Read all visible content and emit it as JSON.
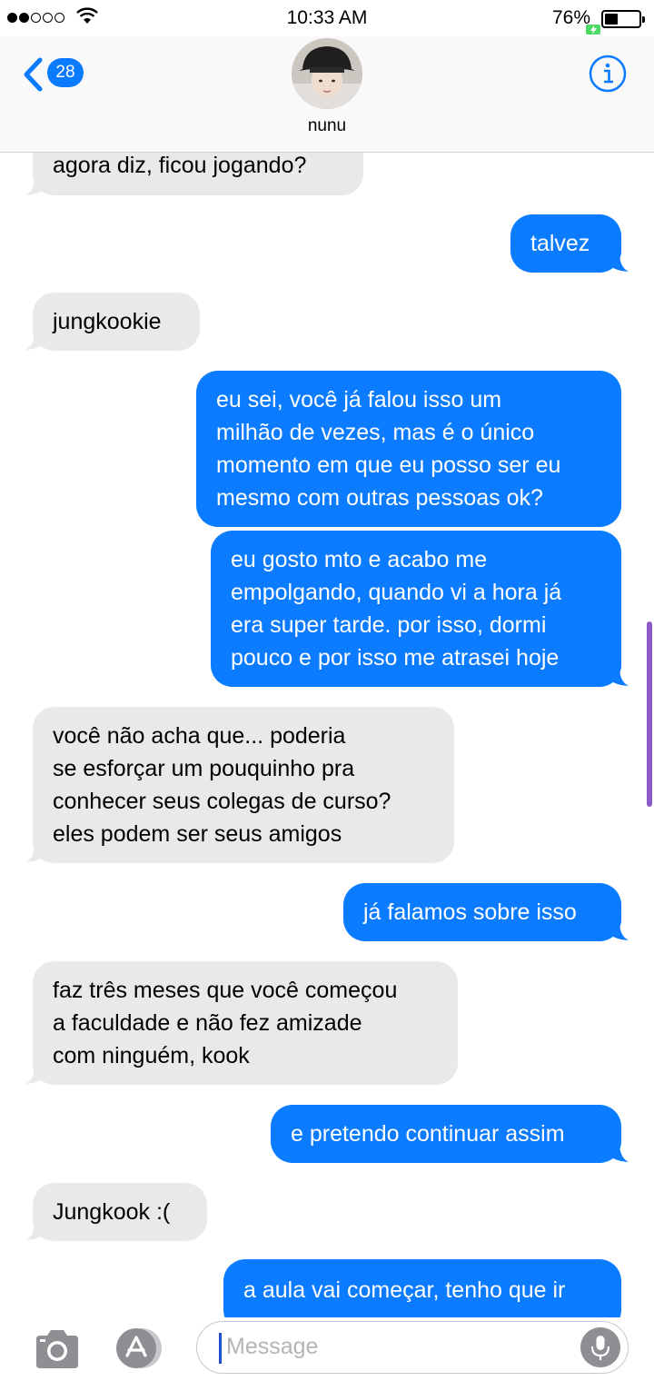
{
  "status_bar": {
    "time": "10:33 AM",
    "battery": "76%"
  },
  "header": {
    "back_count": "28",
    "contact_name": "nunu"
  },
  "messages": [
    {
      "side": "in",
      "text": "agora diz, ficou jogando?"
    },
    {
      "side": "out",
      "text": "talvez"
    },
    {
      "side": "in",
      "text": "jungkookie"
    },
    {
      "side": "out",
      "text": "eu sei, você já falou isso um\nmilhão de vezes, mas é o único\nmomento em que eu posso ser eu\nmesmo com outras pessoas ok?"
    },
    {
      "side": "out",
      "text": "eu gosto mto e acabo me\nempolgando, quando vi a hora já\nera super tarde. por isso, dormi\npouco e por isso me atrasei hoje"
    },
    {
      "side": "in",
      "text": "você não acha que... poderia\nse esforçar um pouquinho pra\nconhecer seus colegas de curso?\neles podem ser seus amigos"
    },
    {
      "side": "out",
      "text": "já falamos sobre isso"
    },
    {
      "side": "in",
      "text": "faz três meses que você começou\na faculdade e não fez amizade\ncom ninguém, kook"
    },
    {
      "side": "out",
      "text": "e pretendo continuar assim"
    },
    {
      "side": "in",
      "text": "Jungkook :("
    },
    {
      "side": "out",
      "text": "a aula vai começar, tenho que ir"
    }
  ],
  "input": {
    "placeholder": "Message"
  },
  "colors": {
    "outgoing": "#0b7bff",
    "incoming": "#e9e9eb",
    "accent": "#0a7aff"
  },
  "icons": [
    "wifi-icon",
    "battery-icon",
    "back-chevron-icon",
    "info-icon",
    "camera-icon",
    "appstore-icon",
    "microphone-icon"
  ]
}
